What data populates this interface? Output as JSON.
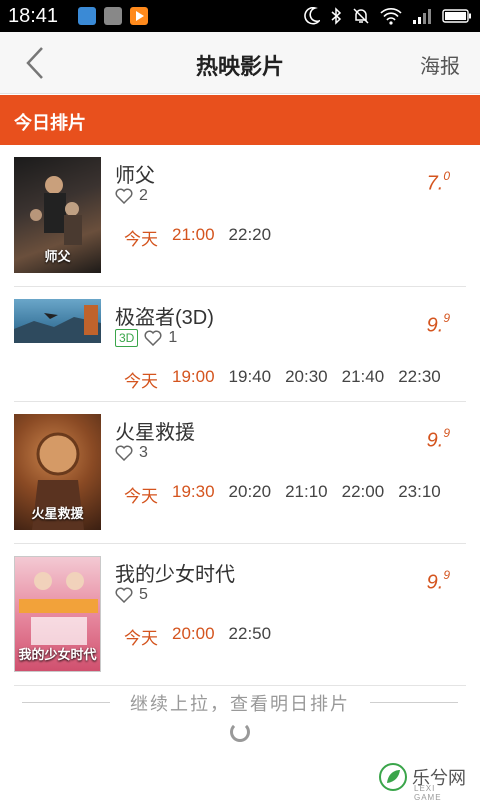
{
  "status_bar": {
    "time": "18:41"
  },
  "header": {
    "title": "热映影片",
    "poster_label": "海报"
  },
  "section": {
    "title": "今日排片"
  },
  "movies": [
    {
      "name": "师父",
      "likes": "2",
      "badge": "",
      "rating_main": "7.",
      "rating_sup": "0",
      "today_label": "今天",
      "times": [
        "21:00",
        "22:20"
      ],
      "poster_caption": "师父"
    },
    {
      "name": "极盗者(3D)",
      "likes": "1",
      "badge": "3D",
      "rating_main": "9.",
      "rating_sup": "9",
      "today_label": "今天",
      "times": [
        "19:00",
        "19:40",
        "20:30",
        "21:40",
        "22:30"
      ],
      "poster_caption": ""
    },
    {
      "name": "火星救援",
      "likes": "3",
      "badge": "",
      "rating_main": "9.",
      "rating_sup": "9",
      "today_label": "今天",
      "times": [
        "19:30",
        "20:20",
        "21:10",
        "22:00",
        "23:10"
      ],
      "poster_caption": "火星救援"
    },
    {
      "name": "我的少女时代",
      "likes": "5",
      "badge": "",
      "rating_main": "9.",
      "rating_sup": "9",
      "today_label": "今天",
      "times": [
        "20:00",
        "22:50"
      ],
      "poster_caption": "我的少女时代"
    }
  ],
  "footer": {
    "pull_hint": "继续上拉，查看明日排片"
  },
  "watermark": {
    "text": "乐兮网",
    "sub": "LEXI GAME"
  },
  "colors": {
    "accent": "#e8501d",
    "rating": "#d4541e",
    "badge_3d": "#3aa54a"
  }
}
